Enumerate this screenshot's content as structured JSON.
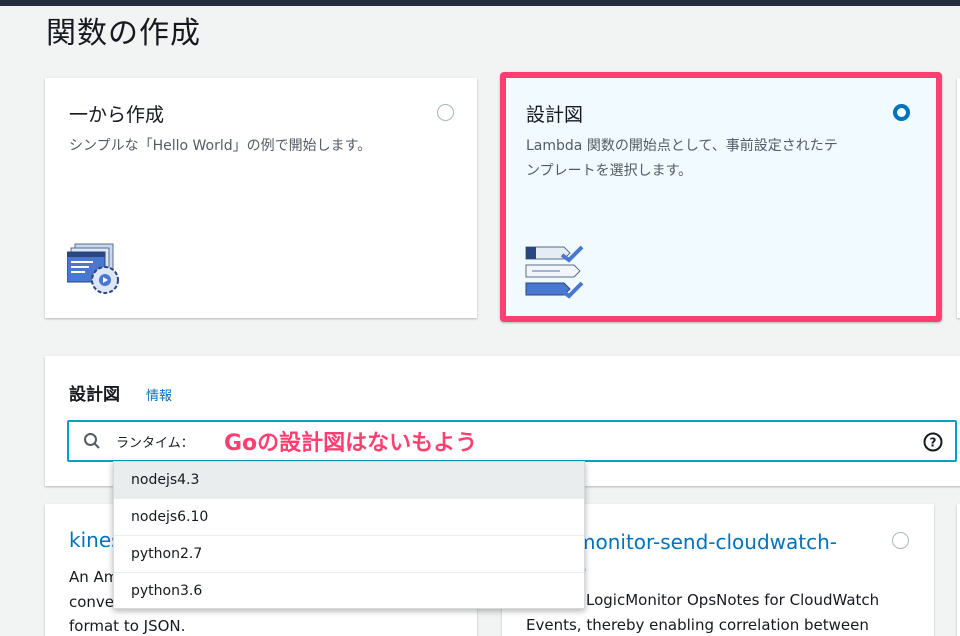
{
  "page": {
    "title": "関数の作成"
  },
  "options": {
    "scratch": {
      "title": "一から作成",
      "description": "シンプルな「Hello World」の例で開始します。",
      "selected": false,
      "icon": "code-gear-icon"
    },
    "blueprint": {
      "title": "設計図",
      "description_line1": "Lambda 関数の開始点として、事前設定されたテ",
      "description_line2": "ンプレートを選択します。",
      "selected": true,
      "icon": "checklist-icon"
    }
  },
  "blueprints_panel": {
    "title": "設計図",
    "info_label": "情報",
    "search": {
      "token": "ランタイム："
    },
    "annotation": "Goの設計図はないもよう"
  },
  "runtime_dropdown": {
    "items": [
      "nodejs4.3",
      "nodejs6.10",
      "python2.7",
      "python3.6"
    ],
    "highlighted_index": 0
  },
  "results": {
    "left": {
      "title_fragment": "kines",
      "desc_line1": "An Am",
      "desc_line2": "conve",
      "desc_line3": "format to JSON."
    },
    "right": {
      "title_line1": "monitor-send-cloudwatch-",
      "title_line2": "s",
      "desc_line1": "LogicMonitor OpsNotes for CloudWatch",
      "desc_line2": "Events, thereby enabling correlation between"
    }
  },
  "colors": {
    "accent": "#0073bb",
    "highlight": "#ff3f72",
    "focus": "#00a1c9"
  }
}
